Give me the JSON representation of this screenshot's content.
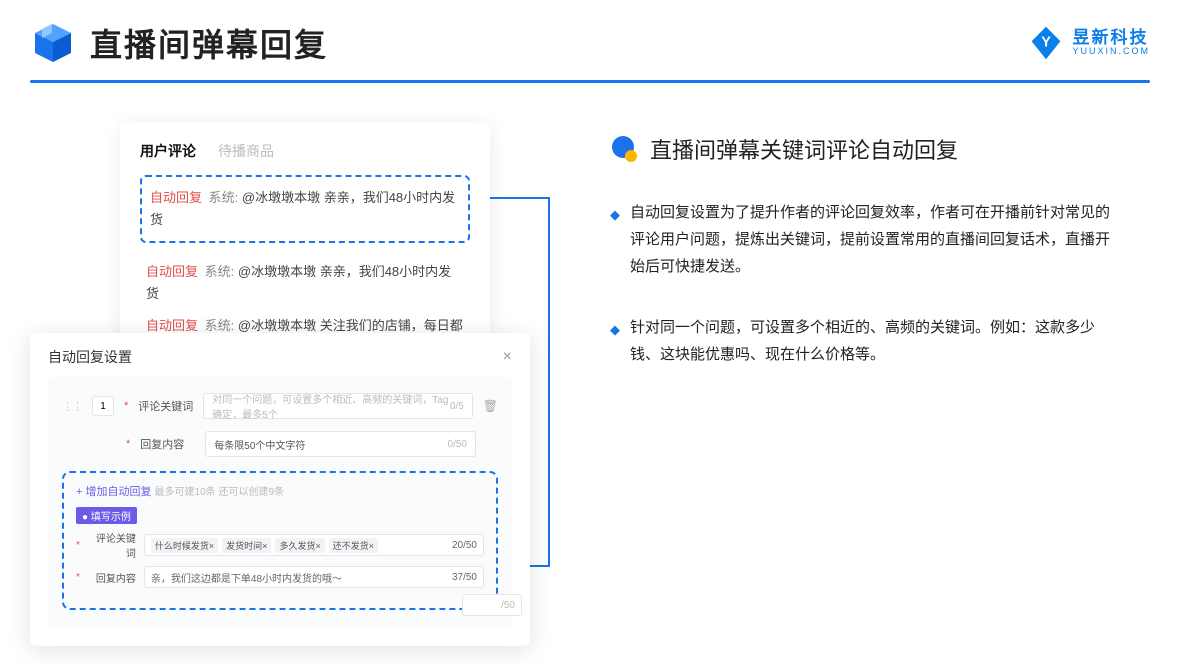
{
  "header": {
    "title": "直播间弹幕回复",
    "logo_cn": "昱新科技",
    "logo_en": "YUUXIN.COM"
  },
  "comments_panel": {
    "tab_active": "用户评论",
    "tab_inactive": "待播商品",
    "auto_reply_label": "自动回复",
    "system_label": "系统:",
    "comment1": "@冰墩墩本墩 亲亲，我们48小时内发货",
    "comment2": "@冰墩墩本墩 亲亲，我们48小时内发货",
    "comment3": "@冰墩墩本墩 关注我们的店铺，每日都有热门推荐呦～"
  },
  "settings_panel": {
    "title": "自动回复设置",
    "index": "1",
    "label_keyword": "评论关键词",
    "placeholder_keyword": "对同一个问题，可设置多个相近、高频的关键词，Tag确定，最多5个",
    "counter_keyword": "0/5",
    "label_content": "回复内容",
    "placeholder_content": "每条限50个中文字符",
    "counter_content": "0/50",
    "add_link": "+ 增加自动回复",
    "add_hint": "最多可建10条 还可以创建9条",
    "example_badge": "● 填写示例",
    "example_label_keyword": "评论关键词",
    "example_tags": [
      "什么时候发货×",
      "发货时间×",
      "多久发货×",
      "还不发货×"
    ],
    "example_counter_keyword": "20/50",
    "example_label_content": "回复内容",
    "example_value_content": "亲，我们这边都是下单48小时内发货的哦～",
    "example_counter_content": "37/50",
    "overhang_counter": "/50"
  },
  "right": {
    "section_title": "直播间弹幕关键词评论自动回复",
    "bullet1": "自动回复设置为了提升作者的评论回复效率，作者可在开播前针对常见的评论用户问题，提炼出关键词，提前设置常用的直播间回复话术，直播开始后可快捷发送。",
    "bullet2": "针对同一个问题，可设置多个相近的、高频的关键词。例如：这款多少钱、这块能优惠吗、现在什么价格等。"
  }
}
